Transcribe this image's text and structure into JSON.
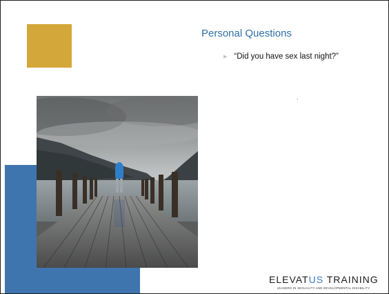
{
  "slide": {
    "title": "Personal Questions",
    "bullets": [
      "“Did you have sex last night?”"
    ],
    "bullet_marker_icon": "triangle-right-icon"
  },
  "colors": {
    "gold": "#d4a73a",
    "blue": "#3f75ae",
    "title": "#2f6fa6"
  },
  "brand": {
    "name_part1": "ELEVAT",
    "name_part2": "US",
    "name_part3": " TRAINING",
    "tagline": "LEADERS IN SEXUALITY AND DEVELOPMENTAL DISABILITY"
  }
}
